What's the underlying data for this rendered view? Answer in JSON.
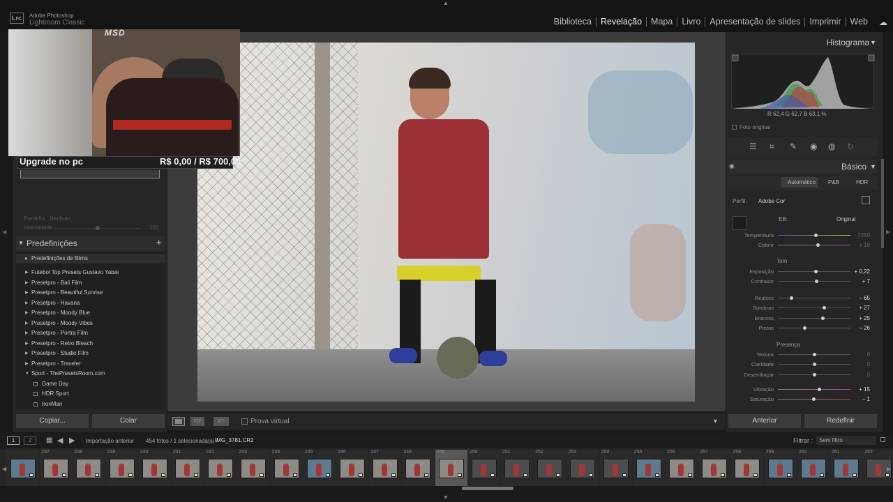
{
  "app": {
    "vendor": "Adobe Photoshop",
    "name": "Lightroom Classic",
    "logo": "Lrc"
  },
  "modules": [
    "Biblioteca",
    "Revelação",
    "Mapa",
    "Livro",
    "Apresentação de slides",
    "Imprimir",
    "Web"
  ],
  "active_module": "Revelação",
  "stream_overlay": {
    "tag": "MSD",
    "goal_label": "Upgrade no pc",
    "goal_value": "R$ 0,00 / R$ 700,00"
  },
  "left_panel": {
    "preset_label": "Predefin.",
    "preset_value": "Nenhum",
    "intensity_label": "Intensidade",
    "intensity_value": "100",
    "intensity_level": 0.52,
    "presets_title": "Predefinições",
    "presets": [
      {
        "label": "Predefinições de filtros",
        "kind": "filter"
      },
      {
        "label": "Futebol Top Presets Gustavo Yabai",
        "kind": "folder"
      },
      {
        "label": "Presetpro - Bali Film",
        "kind": "folder"
      },
      {
        "label": "Presetpro - Beautiful Sunrise",
        "kind": "folder"
      },
      {
        "label": "Presetpro - Havana",
        "kind": "folder"
      },
      {
        "label": "Presetpro - Moody Blue",
        "kind": "folder"
      },
      {
        "label": "Presetpro - Moody Vibes",
        "kind": "folder"
      },
      {
        "label": "Presetpro - Portra Film",
        "kind": "folder"
      },
      {
        "label": "Presetpro - Retro Bleach",
        "kind": "folder"
      },
      {
        "label": "Presetpro - Studio Film",
        "kind": "folder"
      },
      {
        "label": "Presetpro - Traveler",
        "kind": "folder"
      },
      {
        "label": "Sport - ThePresetsRoom.com",
        "kind": "open"
      },
      {
        "label": "Game Day",
        "kind": "preset"
      },
      {
        "label": "HDR Sport",
        "kind": "preset"
      },
      {
        "label": "IronMan",
        "kind": "preset"
      }
    ],
    "copy_label": "Copiar...",
    "paste_label": "Colar"
  },
  "toolbar": {
    "soft_proof_label": "Prova virtual"
  },
  "right_panel": {
    "histogram_title": "Histograma",
    "rgb_readout": "R 62,4  G 62,7  B 63,1 %",
    "original_photo_label": "Foto original",
    "basic_title": "Básico",
    "treatments": [
      "Automático",
      "P&B",
      "HDR"
    ],
    "profile_label": "Perfil:",
    "profile_value": "Adobe Cor",
    "wb_label": "EB:",
    "wb_value": "Original",
    "tone_title": "Tom",
    "presence_title": "Presença",
    "previous_label": "Anterior",
    "reset_label": "Redefinir",
    "sliders": [
      {
        "label": "Temperatura",
        "value": "7250",
        "level": 0.52,
        "dim": true,
        "track": "temp",
        "group": "wb"
      },
      {
        "label": "Colorir",
        "value": "+ 19",
        "level": 0.55,
        "dim": true,
        "track": "tint",
        "group": "wb"
      },
      {
        "label": "Exposição",
        "value": "+ 0,22",
        "level": 0.52,
        "dim": false,
        "track": "gray",
        "group": "tone1"
      },
      {
        "label": "Contraste",
        "value": "+ 7",
        "level": 0.53,
        "dim": false,
        "track": "gray",
        "group": "tone1"
      },
      {
        "label": "Realces",
        "value": "– 65",
        "level": 0.18,
        "dim": false,
        "track": "gray",
        "group": "tone2"
      },
      {
        "label": "Sombras",
        "value": "+ 27",
        "level": 0.63,
        "dim": false,
        "track": "gray",
        "group": "tone2"
      },
      {
        "label": "Brancos",
        "value": "+ 25",
        "level": 0.62,
        "dim": false,
        "track": "gray",
        "group": "tone2"
      },
      {
        "label": "Pretos",
        "value": "– 26",
        "level": 0.37,
        "dim": false,
        "track": "gray",
        "group": "tone2"
      },
      {
        "label": "Textura",
        "value": "0",
        "level": 0.5,
        "dim": true,
        "track": "gray",
        "group": "presence"
      },
      {
        "label": "Claridade",
        "value": "0",
        "level": 0.5,
        "dim": true,
        "track": "gray",
        "group": "presence"
      },
      {
        "label": "Desembaçar",
        "value": "0",
        "level": 0.5,
        "dim": true,
        "track": "gray",
        "group": "presence"
      },
      {
        "label": "Vibração",
        "value": "+ 15",
        "level": 0.57,
        "dim": false,
        "track": "vib",
        "group": "presence2"
      },
      {
        "label": "Saturação",
        "value": "– 1",
        "level": 0.49,
        "dim": false,
        "track": "sat",
        "group": "presence2"
      }
    ]
  },
  "filmstrip_bar": {
    "view_1": "1",
    "view_2": "2",
    "source": "Importação anterior",
    "count": "454 fotos / 1 selecionada(s) /",
    "file": "IMG_3781.CR2",
    "filter_label": "Filtrar :",
    "filter_value": "Sem filtro"
  },
  "filmstrip": {
    "numbers": [
      "",
      "237",
      "238",
      "239",
      "240",
      "241",
      "242",
      "243",
      "244",
      "245",
      "246",
      "247",
      "248",
      "249",
      "250",
      "251",
      "252",
      "253",
      "254",
      "255",
      "256",
      "257",
      "258",
      "259",
      "260",
      "261",
      "262"
    ],
    "selected_index": 13,
    "variants": [
      "blue",
      "gray",
      "gray",
      "gray",
      "gray",
      "gray",
      "gray",
      "gray",
      "gray",
      "blue",
      "gray",
      "gray",
      "gray",
      "gray",
      "dark",
      "dark",
      "dark",
      "dark",
      "dark",
      "blue",
      "gray",
      "gray",
      "gray",
      "blue",
      "blue",
      "blue",
      "dark"
    ]
  }
}
